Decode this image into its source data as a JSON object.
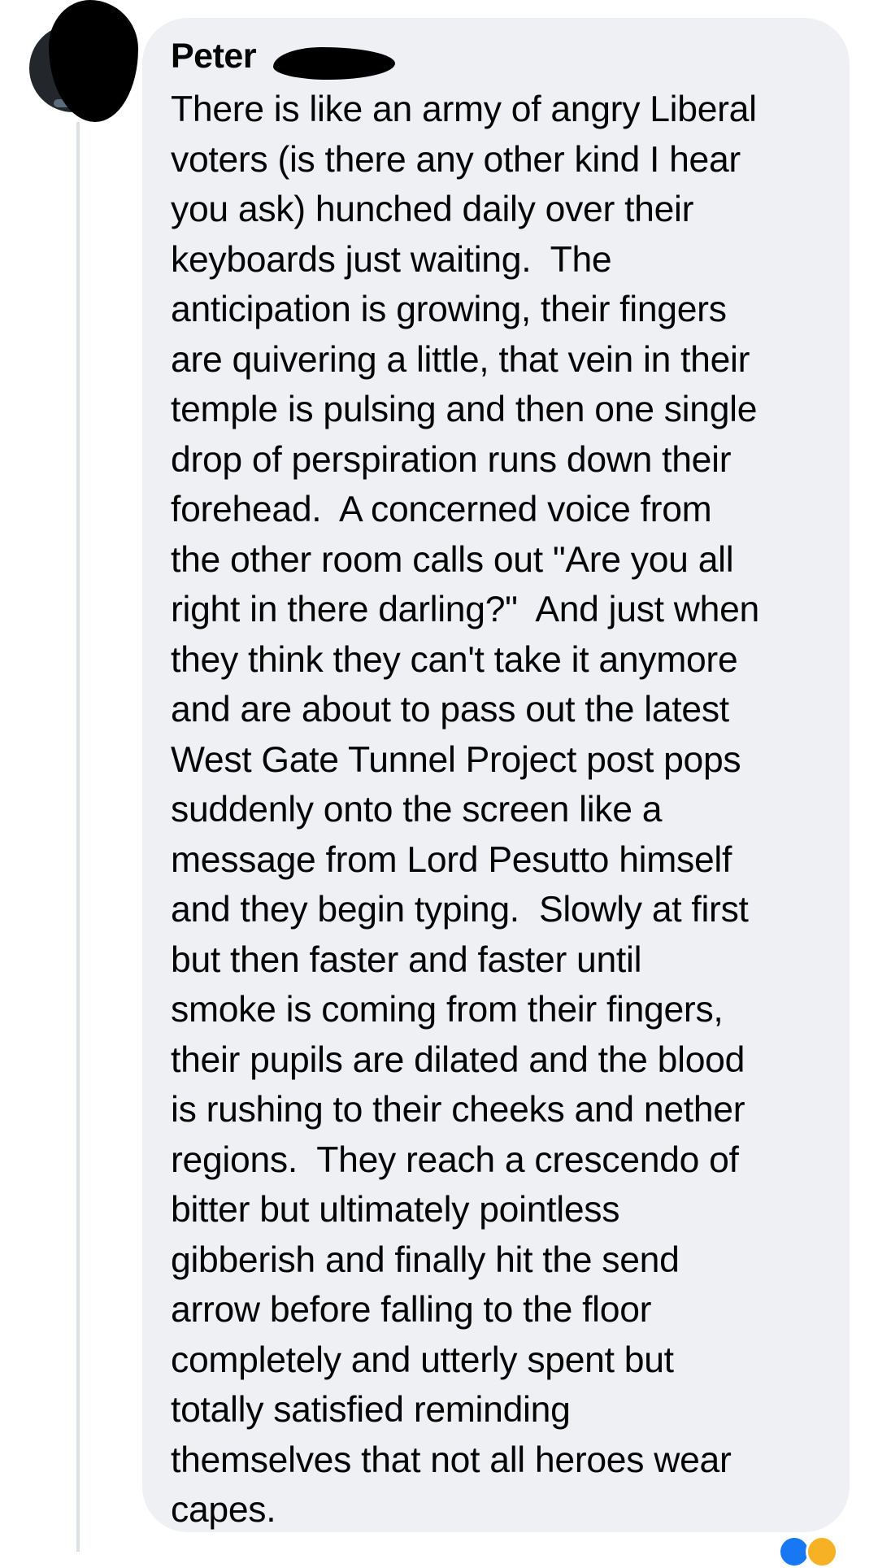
{
  "comment": {
    "author": "Peter",
    "text_lines": [
      "There is like an army of angry Liberal",
      "voters (is there any other kind I hear",
      "you ask) hunched daily over their",
      "keyboards just waiting.  The",
      "anticipation is growing, their fingers",
      "are quivering a little, that vein in their",
      "temple is pulsing and then one single",
      "drop of perspiration runs down their",
      "forehead.  A concerned voice from",
      "the other room calls out \"Are you all",
      "right in there darling?\"  And just when",
      "they think they can't take it anymore",
      "and are about to pass out the latest",
      "West Gate Tunnel Project post pops",
      "suddenly onto the screen like a",
      "message from Lord Pesutto himself",
      "and they begin typing.  Slowly at first",
      "but then faster and faster until",
      "smoke is coming from their fingers,",
      "their pupils are dilated and the blood",
      "is rushing to their cheeks and nether",
      "regions.  They reach a crescendo of",
      "bitter but ultimately pointless",
      "gibberish and finally hit the send",
      "arrow before falling to the floor",
      "completely and utterly spent but",
      "totally satisfied reminding",
      "themselves that not all heroes wear",
      "capes."
    ]
  },
  "reactions": {
    "icons": [
      "like-icon",
      "haha-icon"
    ],
    "colors": {
      "like": "#1877f2",
      "haha": "#f7b125"
    }
  },
  "colors": {
    "bubble": "#eff0f4",
    "text": "#050505",
    "thread_line": "#dde0e5"
  }
}
